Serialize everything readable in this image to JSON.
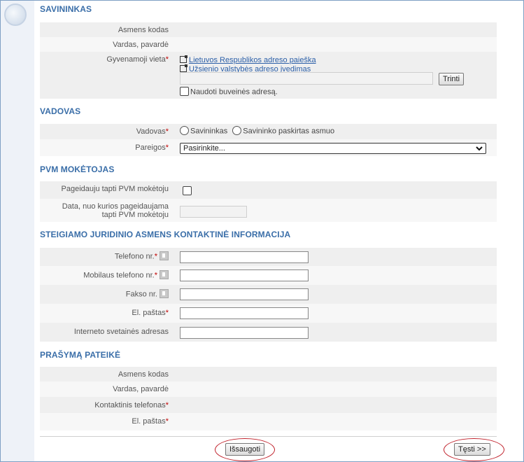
{
  "savininkas": {
    "title": "SAVININKAS",
    "asmens_kodas_label": "Asmens kodas",
    "vardas_label": "Vardas, pavardė",
    "gyvenamoji_label": "Gyvenamoji vieta",
    "required_mark": "*",
    "link_lr": "Lietuvos Respublikos adreso paieška",
    "link_foreign": "Užsienio valstybės adreso įvedimas",
    "address_value": "",
    "trinti_label": "Trinti",
    "buveine_checkbox_label": "Naudoti buveinės adresą."
  },
  "vadovas": {
    "title": "VADOVAS",
    "vadovas_label": "Vadovas",
    "radio_savininkas": "Savininkas",
    "radio_paskirtas": "Savininko paskirtas asmuo",
    "pareigos_label": "Pareigos",
    "pareigos_selected": "Pasirinkite..."
  },
  "pvm": {
    "title": "PVM MOKĖTOJAS",
    "pageidauju_label": "Pageidauju tapti PVM mokėtoju",
    "data_label_line1": "Data, nuo kurios pageidaujama",
    "data_label_line2": "tapti PVM mokėtoju",
    "data_value": ""
  },
  "kontaktai": {
    "title": "STEIGIAMO JURIDINIO ASMENS KONTAKTINĖ INFORMACIJA",
    "telefono_label": "Telefono nr.",
    "mobilaus_label": "Mobilaus telefono nr.",
    "fakso_label": "Fakso nr.",
    "pastas_label": "El. paštas",
    "svetaine_label": "Interneto svetainės adresas",
    "telefono_value": "",
    "mobilaus_value": "",
    "fakso_value": "",
    "pastas_value": "",
    "svetaine_value": ""
  },
  "prasyma": {
    "title": "PRAŠYMĄ PATEIKĖ",
    "asmens_kodas_label": "Asmens kodas",
    "vardas_label": "Vardas, pavardė",
    "telefonas_label": "Kontaktinis telefonas",
    "pastas_label": "El. paštas"
  },
  "buttons": {
    "issaugoti": "Išsaugoti",
    "testi": "Tęsti >>"
  },
  "colors": {
    "section_title": "#3a6ea8",
    "required": "#c00000",
    "highlight_oval": "#c0212b",
    "link": "#2b5fa8"
  }
}
